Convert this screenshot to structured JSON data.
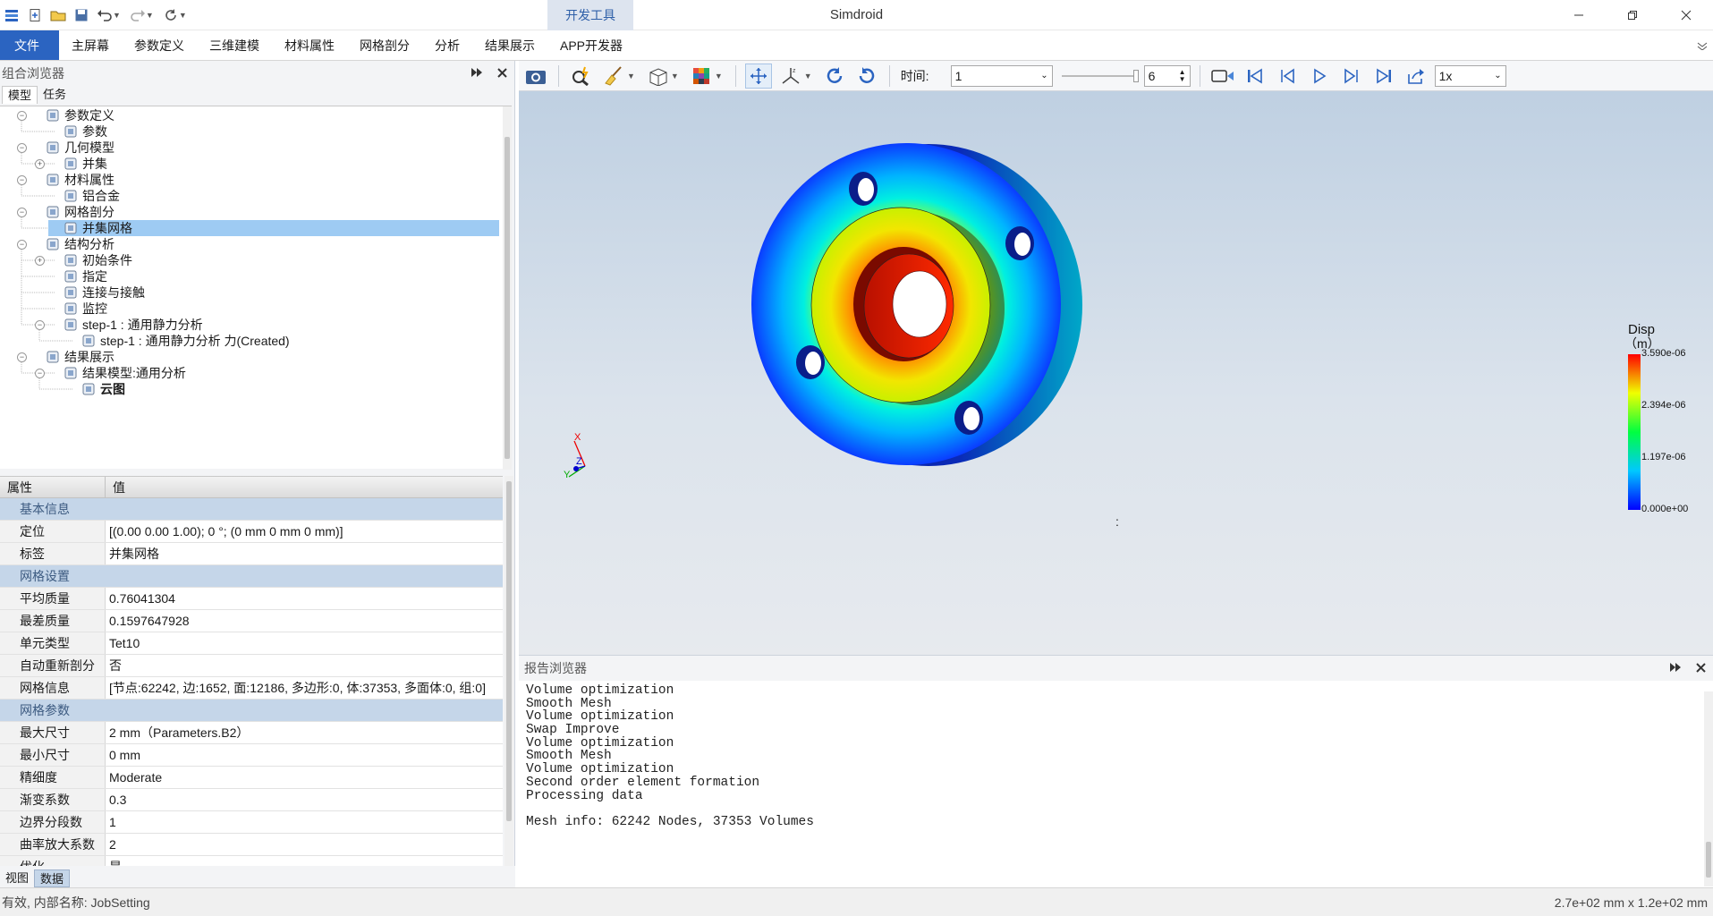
{
  "app": {
    "title": "Simdroid",
    "dev_tab": "开发工具"
  },
  "menu": [
    "文件",
    "主屏幕",
    "参数定义",
    "三维建模",
    "材料属性",
    "网格剖分",
    "分析",
    "结果展示",
    "APP开发器"
  ],
  "component_browser": {
    "title": "组合浏览器",
    "tabs": [
      "模型",
      "任务"
    ],
    "tree": [
      {
        "label": "参数定义",
        "level": 0,
        "toggle": "-",
        "icon": "parameter-def-icon"
      },
      {
        "label": "参数",
        "level": 1,
        "toggle": "",
        "icon": "xt-function-icon"
      },
      {
        "label": "几何模型",
        "level": 0,
        "toggle": "-",
        "icon": "geometry-icon"
      },
      {
        "label": "并集",
        "level": 1,
        "toggle": "+",
        "icon": "union-icon"
      },
      {
        "label": "材料属性",
        "level": 0,
        "toggle": "-",
        "icon": "material-icon"
      },
      {
        "label": "铝合金",
        "level": 1,
        "toggle": "",
        "icon": "material-icon"
      },
      {
        "label": "网格剖分",
        "level": 0,
        "toggle": "-",
        "icon": "mesh-icon"
      },
      {
        "label": "并集网格",
        "level": 1,
        "toggle": "",
        "icon": "mesh-item-icon",
        "selected": true
      },
      {
        "label": "结构分析",
        "level": 0,
        "toggle": "-",
        "icon": "structure-icon"
      },
      {
        "label": "初始条件",
        "level": 1,
        "toggle": "+",
        "icon": "initial-condition-icon"
      },
      {
        "label": "指定",
        "level": 1,
        "toggle": "",
        "icon": "specify-icon"
      },
      {
        "label": "连接与接触",
        "level": 1,
        "toggle": "",
        "icon": "contact-icon"
      },
      {
        "label": "监控",
        "level": 1,
        "toggle": "",
        "icon": "monitor-icon"
      },
      {
        "label": "step-1 : 通用静力分析",
        "level": 1,
        "toggle": "-",
        "icon": "step-icon"
      },
      {
        "label": "step-1 : 通用静力分析 力(Created)",
        "level": 2,
        "toggle": "",
        "icon": "load-icon"
      },
      {
        "label": "结果展示",
        "level": 0,
        "toggle": "-",
        "icon": "result-icon"
      },
      {
        "label": "结果模型:通用分析",
        "level": 1,
        "toggle": "-",
        "icon": "result-model-icon"
      },
      {
        "label": "云图",
        "level": 2,
        "toggle": "",
        "icon": "contour-icon",
        "bold": true
      }
    ]
  },
  "properties": {
    "headers": [
      "属性",
      "值"
    ],
    "rows": [
      {
        "type": "cat",
        "k": "基本信息"
      },
      {
        "k": "定位",
        "v": "[(0.00 0.00 1.00); 0 °; (0 mm  0 mm  0 mm)]",
        "exp": true
      },
      {
        "k": "标签",
        "v": "并集网格"
      },
      {
        "type": "cat",
        "k": "网格设置"
      },
      {
        "k": "平均质量",
        "v": "0.76041304"
      },
      {
        "k": "最差质量",
        "v": "0.1597647928"
      },
      {
        "k": "单元类型",
        "v": "Tet10"
      },
      {
        "k": "自动重新剖分",
        "v": "否"
      },
      {
        "k": "网格信息",
        "v": "[节点:62242, 边:1652, 面:12186, 多边形:0, 体:37353, 多面体:0, 组:0]",
        "exp": true
      },
      {
        "type": "cat",
        "k": "网格参数"
      },
      {
        "k": "最大尺寸",
        "v": "2 mm（Parameters.B2）"
      },
      {
        "k": "最小尺寸",
        "v": "0 mm"
      },
      {
        "k": "精细度",
        "v": "Moderate"
      },
      {
        "k": "渐变系数",
        "v": "0.3"
      },
      {
        "k": "边界分段数",
        "v": "1"
      },
      {
        "k": "曲率放大系数",
        "v": "2"
      },
      {
        "k": "优化",
        "v": "是"
      }
    ]
  },
  "bottom_tabs": [
    "视图",
    "数据"
  ],
  "viewer_toolbar": {
    "time_label": "时间:",
    "time_value": "1",
    "step_value": "6",
    "speed_value": "1x"
  },
  "legend": {
    "title": "Disp",
    "unit": "（m）",
    "ticks": [
      "3.590e-06",
      "2.394e-06",
      "1.197e-06",
      "0.000e+00"
    ]
  },
  "axes": {
    "x": "X",
    "y": "Y",
    "z": "Z"
  },
  "viewport_colon": ":",
  "report": {
    "title": "报告浏览器",
    "lines": [
      "Volume optimization",
      "Smooth Mesh",
      "Volume optimization",
      "Swap Improve",
      "Volume optimization",
      "Smooth Mesh",
      "Volume optimization",
      "Second order element formation",
      "Processing data",
      "",
      "Mesh info: 62242 Nodes, 37353 Volumes"
    ]
  },
  "status": {
    "left": "有效, 内部名称: JobSetting",
    "right": "2.7e+02 mm x 1.2e+02 mm"
  }
}
